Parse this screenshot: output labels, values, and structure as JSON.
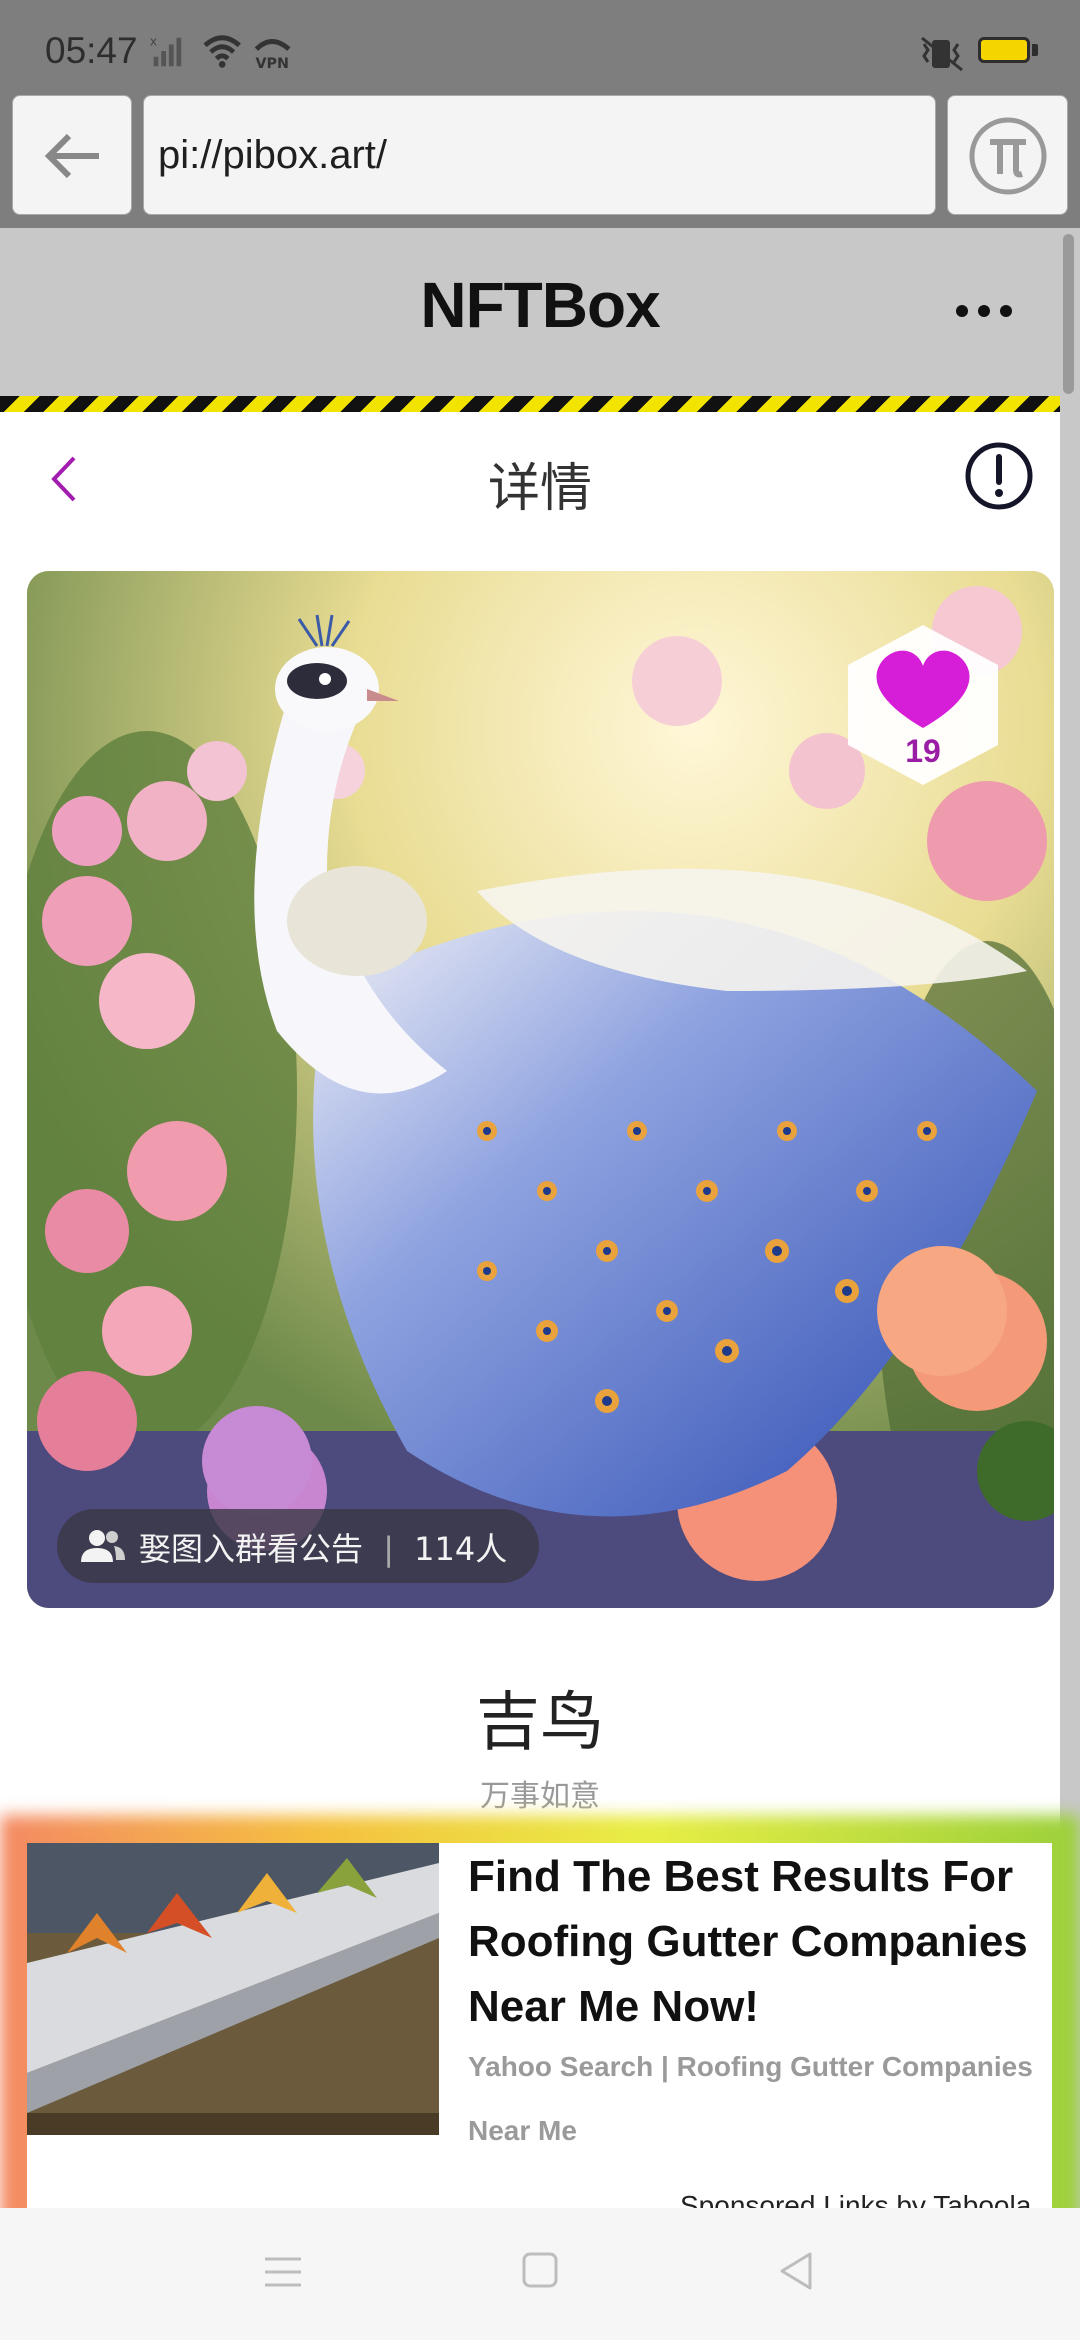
{
  "status_bar": {
    "time": "05:47",
    "icons_left": [
      "signal-icon",
      "wifi-icon",
      "vpn-icon"
    ],
    "vpn_label": "VPN",
    "icons_right": [
      "vibrate-icon",
      "battery-icon"
    ],
    "battery_color": "#f5d500"
  },
  "browser": {
    "url": "pi://pibox.art/",
    "back_icon": "arrow-left-icon",
    "pi_icon": "pi-logo-icon"
  },
  "app": {
    "title": "NFTBox",
    "more_icon": "more-horizontal-icon",
    "header_color": "#c8c8c8"
  },
  "detail": {
    "title": "详情",
    "back_icon": "chevron-left-icon",
    "back_color": "#a21caf",
    "info_icon": "exclamation-circle-icon"
  },
  "artwork": {
    "subject": "white peacock among flowers",
    "likes": "19",
    "heart_color": "#d61ed8",
    "group_label": "娶图入群看公告",
    "group_count": "114人"
  },
  "nft": {
    "title": "吉鸟",
    "subtitle": "万事如意"
  },
  "ad": {
    "headline": "Find The Best Results For Roofing Gutter Companies Near Me Now!",
    "source": "Yahoo Search | Roofing Gutter Companies Near Me",
    "sponsored": "Sponsored Links by Taboola"
  },
  "nav_bar": {
    "items": [
      "menu-icon",
      "home-square-icon",
      "back-triangle-icon"
    ]
  }
}
